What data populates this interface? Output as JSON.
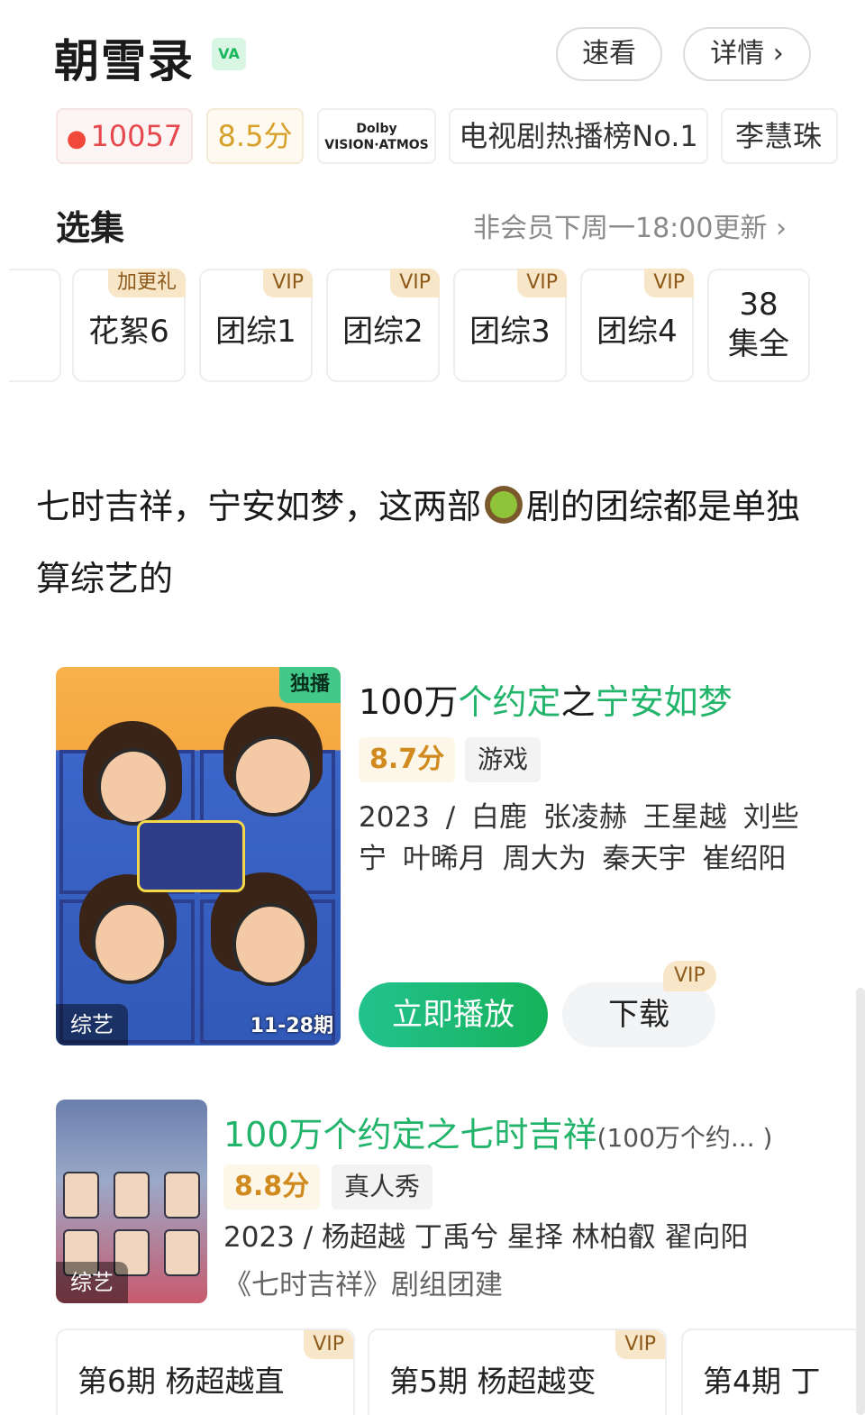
{
  "header": {
    "title": "朝雪录",
    "badge": "VA",
    "quick_view": "速看",
    "details": "详情 ›"
  },
  "tags": {
    "hot_icon": "flame-icon",
    "hot": "10057",
    "score": "8.5分",
    "dolby_line1": "Dolby",
    "dolby_line2": "VISION·ATMOS",
    "rank": "电视剧热播榜No.1",
    "actor": "李慧珠"
  },
  "episodes": {
    "title": "选集",
    "update": "非会员下周一18:00更新 ›",
    "items": [
      {
        "label": "花絮6",
        "badge": "加更礼"
      },
      {
        "label": "团综1",
        "badge": "VIP"
      },
      {
        "label": "团综2",
        "badge": "VIP"
      },
      {
        "label": "团综3",
        "badge": "VIP"
      },
      {
        "label": "团综4",
        "badge": "VIP"
      }
    ],
    "all_top": "38",
    "all_bottom": "集全"
  },
  "post": {
    "text_before": "七时吉祥，宁安如梦，这两部",
    "emoji": "kiwi-icon",
    "text_after": "剧的团综都是单独算综艺的"
  },
  "card1": {
    "exclusive": "独播",
    "category": "综艺",
    "range": "11-28期",
    "title_a": "100万",
    "title_b": "个约定",
    "title_c": "之",
    "title_d": "宁安如梦",
    "score": "8.7分",
    "genre": "游戏",
    "meta": "2023 / 白鹿  张凌赫  王星越  刘些宁  叶晞月  周大为  秦天宇  崔绍阳",
    "play": "立即播放",
    "download": "下载",
    "download_badge": "VIP"
  },
  "card2": {
    "category": "综艺",
    "title": "100万个约定之七时吉祥",
    "title_sub": "(100万个约... )",
    "score": "8.8分",
    "genre": "真人秀",
    "meta": "2023 / 杨超越  丁禹兮  星择  林柏叡  翟向阳",
    "desc": "《七时吉祥》剧组团建",
    "episodes": [
      {
        "text": "第6期 杨超越直",
        "badge": "VIP"
      },
      {
        "text": "第5期 杨超越变",
        "badge": "VIP"
      },
      {
        "text": "第4期 丁",
        "badge": ""
      }
    ]
  },
  "colors": {
    "accent_green": "#21b46a",
    "hot_red": "#e5484d",
    "score_gold": "#d08a1d",
    "vip_bg": "#f8e6c8"
  }
}
